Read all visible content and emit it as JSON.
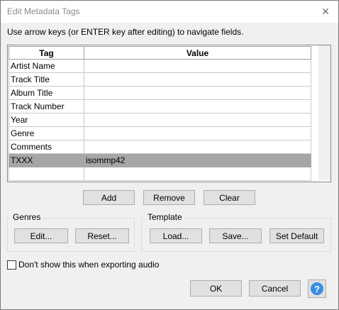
{
  "window": {
    "title": "Edit Metadata Tags",
    "close_glyph": "✕"
  },
  "instructions": "Use arrow keys (or ENTER key after editing) to navigate fields.",
  "table": {
    "headers": [
      "Tag",
      "Value"
    ],
    "rows": [
      {
        "tag": "Artist Name",
        "value": ""
      },
      {
        "tag": "Track Title",
        "value": ""
      },
      {
        "tag": "Album Title",
        "value": ""
      },
      {
        "tag": "Track Number",
        "value": ""
      },
      {
        "tag": "Year",
        "value": ""
      },
      {
        "tag": "Genre",
        "value": ""
      },
      {
        "tag": "Comments",
        "value": ""
      },
      {
        "tag": "TXXX",
        "value": "isommp42"
      },
      {
        "tag": "",
        "value": ""
      }
    ],
    "selected_row": 7
  },
  "row_buttons": {
    "add": "Add",
    "remove": "Remove",
    "clear": "Clear"
  },
  "genres": {
    "label": "Genres",
    "edit": "Edit...",
    "reset": "Reset..."
  },
  "template": {
    "label": "Template",
    "load": "Load...",
    "save": "Save...",
    "set_default": "Set Default"
  },
  "options": {
    "dont_show_label": "Don't show this when exporting audio",
    "dont_show_checked": false
  },
  "footer": {
    "ok": "OK",
    "cancel": "Cancel",
    "help_glyph": "?"
  }
}
